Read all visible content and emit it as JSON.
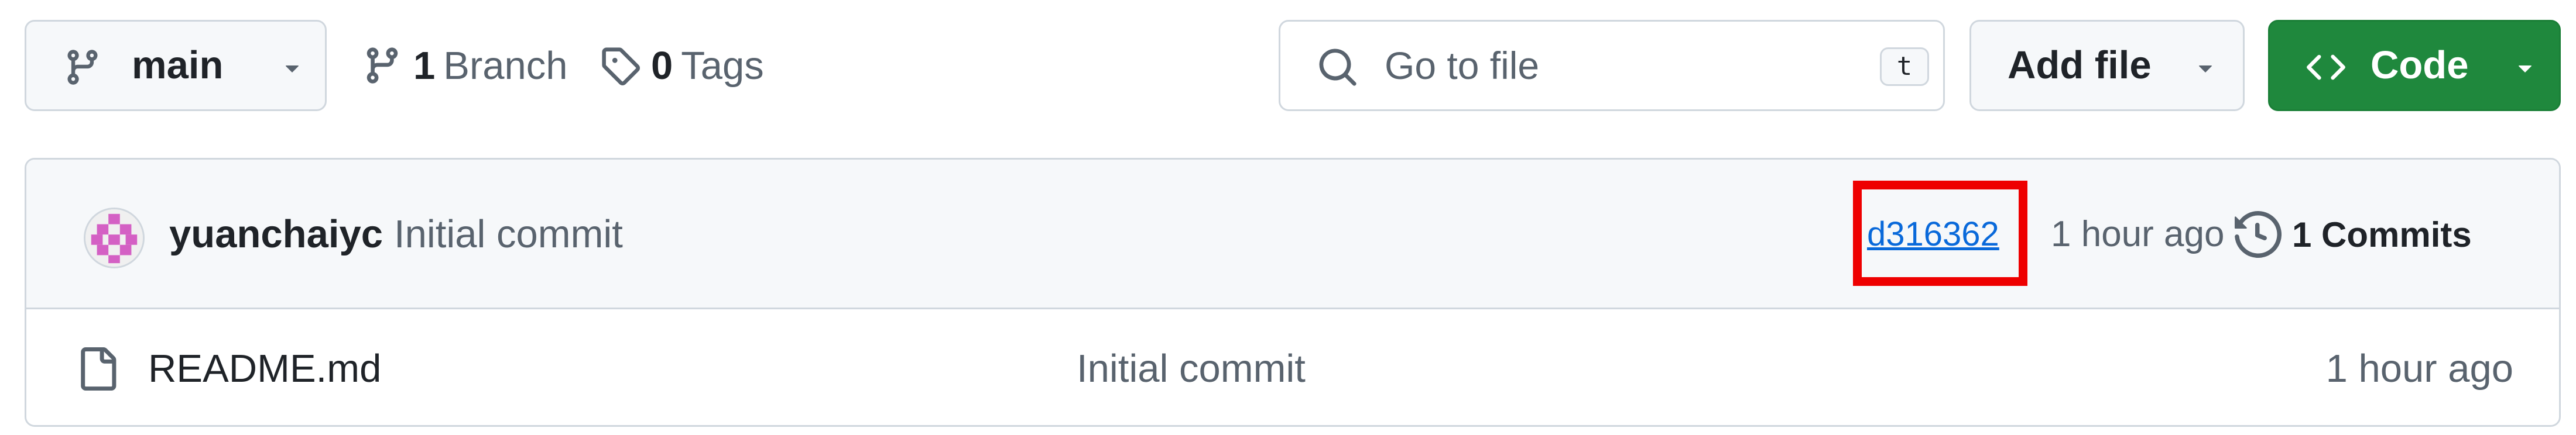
{
  "toolbar": {
    "branch_selector": {
      "label": "main",
      "icon": "git-branch-icon"
    },
    "branches": {
      "count": "1",
      "label": "Branch",
      "icon": "git-branch-icon"
    },
    "tags": {
      "count": "0",
      "label": "Tags",
      "icon": "tag-icon"
    },
    "search": {
      "placeholder": "Go to file",
      "shortcut": "t",
      "icon": "search-icon"
    },
    "add_file": {
      "label": "Add file",
      "icon": "triangle-down-icon"
    },
    "code": {
      "label": "Code",
      "icon": "code-icon",
      "color": "#1f883d"
    }
  },
  "latest_commit": {
    "author": "yuanchaiyc",
    "message": "Initial commit",
    "sha": "d316362",
    "time": "1 hour ago",
    "commits_label": "1 Commits",
    "commits_icon": "history-icon",
    "highlight_color": "#ee0000"
  },
  "files": [
    {
      "name": "README.md",
      "commit_message": "Initial commit",
      "time": "1 hour ago",
      "icon": "file-icon"
    }
  ]
}
